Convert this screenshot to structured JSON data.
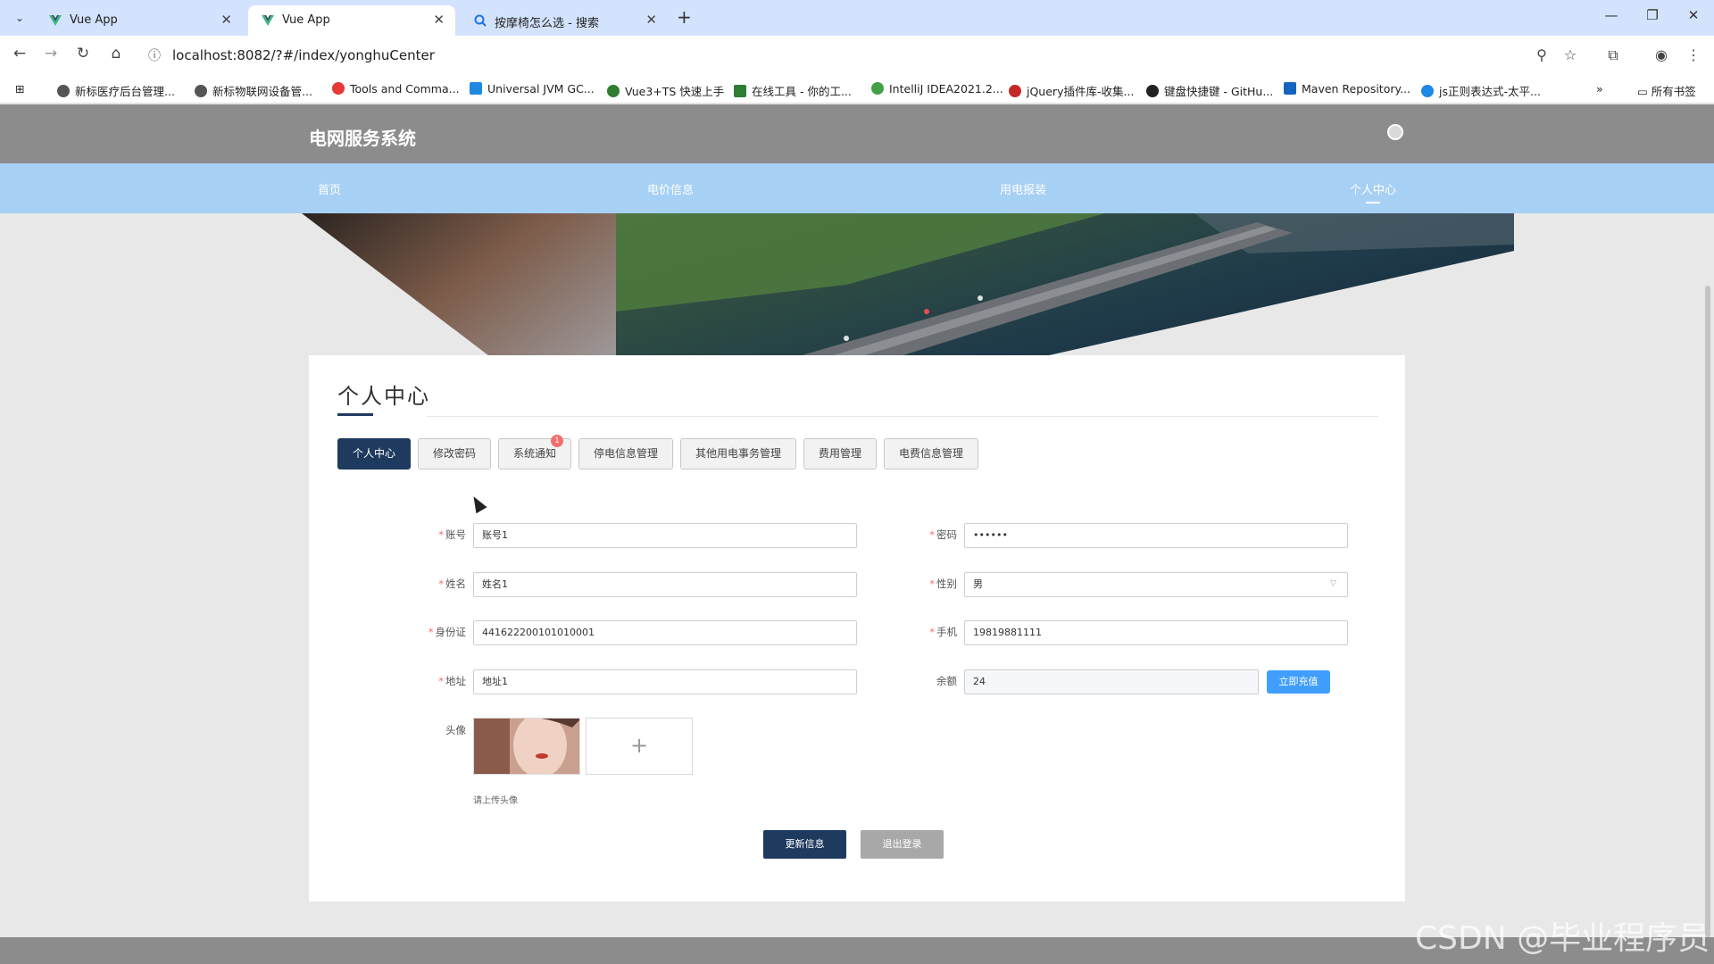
{
  "browser": {
    "tabs": [
      {
        "title": "Vue App",
        "active": false
      },
      {
        "title": "Vue App",
        "active": true
      },
      {
        "title": "按摩椅怎么选 - 搜索",
        "active": false
      }
    ],
    "url": "localhost:8082/?#/index/yonghuCenter",
    "bookmarks": [
      {
        "label": "新标医疗后台管理...",
        "color": "#555555"
      },
      {
        "label": "新标物联网设备管...",
        "color": "#555555"
      },
      {
        "label": "Tools and Comma...",
        "color": "#e53935"
      },
      {
        "label": "Universal JVM GC...",
        "color": "#1e88e5"
      },
      {
        "label": "Vue3+TS 快速上手",
        "color": "#2e7d32"
      },
      {
        "label": "在线工具 - 你的工...",
        "color": "#2e7d32"
      },
      {
        "label": "IntelliJ IDEA2021.2...",
        "color": "#43a047"
      },
      {
        "label": "jQuery插件库-收集...",
        "color": "#c62828"
      },
      {
        "label": "键盘快捷键 - GitHu...",
        "color": "#222222"
      },
      {
        "label": "Maven Repository...",
        "color": "#1565c0"
      },
      {
        "label": "js正则表达式-太平...",
        "color": "#1e88e5"
      }
    ],
    "all_bookmarks": "所有书签"
  },
  "app": {
    "title": "电网服务系统",
    "nav": [
      {
        "label": "首页"
      },
      {
        "label": "电价信息"
      },
      {
        "label": "用电报装"
      },
      {
        "label": "个人中心"
      }
    ]
  },
  "center": {
    "title": "个人中心",
    "tabs": [
      {
        "label": "个人中心",
        "active": true
      },
      {
        "label": "修改密码"
      },
      {
        "label": "系统通知",
        "badge": "1"
      },
      {
        "label": "停电信息管理"
      },
      {
        "label": "其他用电事务管理"
      },
      {
        "label": "费用管理"
      },
      {
        "label": "电费信息管理"
      }
    ]
  },
  "form": {
    "account": {
      "label": "账号",
      "value": "账号1"
    },
    "password": {
      "label": "密码",
      "value": "••••••"
    },
    "name": {
      "label": "姓名",
      "value": "姓名1"
    },
    "gender": {
      "label": "性别",
      "value": "男"
    },
    "id_card": {
      "label": "身份证",
      "value": "441622200101010001"
    },
    "phone": {
      "label": "手机",
      "value": "19819881111"
    },
    "address": {
      "label": "地址",
      "value": "地址1"
    },
    "balance": {
      "label": "余额",
      "value": "24",
      "action": "立即充值"
    },
    "avatar": {
      "label": "头像",
      "hint": "请上传头像",
      "plus": "+"
    }
  },
  "actions": {
    "update": "更新信息",
    "logout": "退出登录"
  },
  "watermark": "CSDN @毕业程序员",
  "colors": {
    "primary": "#1f3a5f",
    "nav": "#a7d0f5",
    "header": "#8c8c8c",
    "accent": "#409eff",
    "badge": "#f56c6c"
  }
}
